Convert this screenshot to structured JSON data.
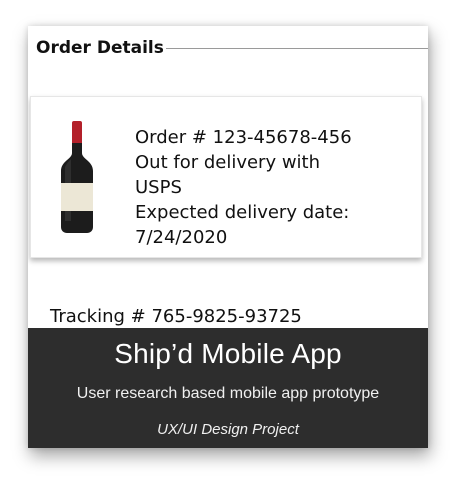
{
  "section": {
    "title": "Order Details"
  },
  "order": {
    "number_label": "Order # 123-45678-456",
    "status_line1": "Out for delivery with",
    "status_line2": "USPS",
    "expected_label": "Expected delivery date:",
    "expected_date": "7/24/2020",
    "product_image_icon": "wine-bottle-icon"
  },
  "tracking": {
    "label": "Tracking # 765-9825-93725"
  },
  "banner": {
    "title": "Ship’d Mobile App",
    "subtitle": "User research based mobile app prototype",
    "tagline": "UX/UI Design Project"
  },
  "colors": {
    "banner_bg": "#2d2d2d",
    "bottle_glass": "#1c1c1c",
    "bottle_capsule": "#b3202a",
    "bottle_label": "#ece7d6"
  }
}
